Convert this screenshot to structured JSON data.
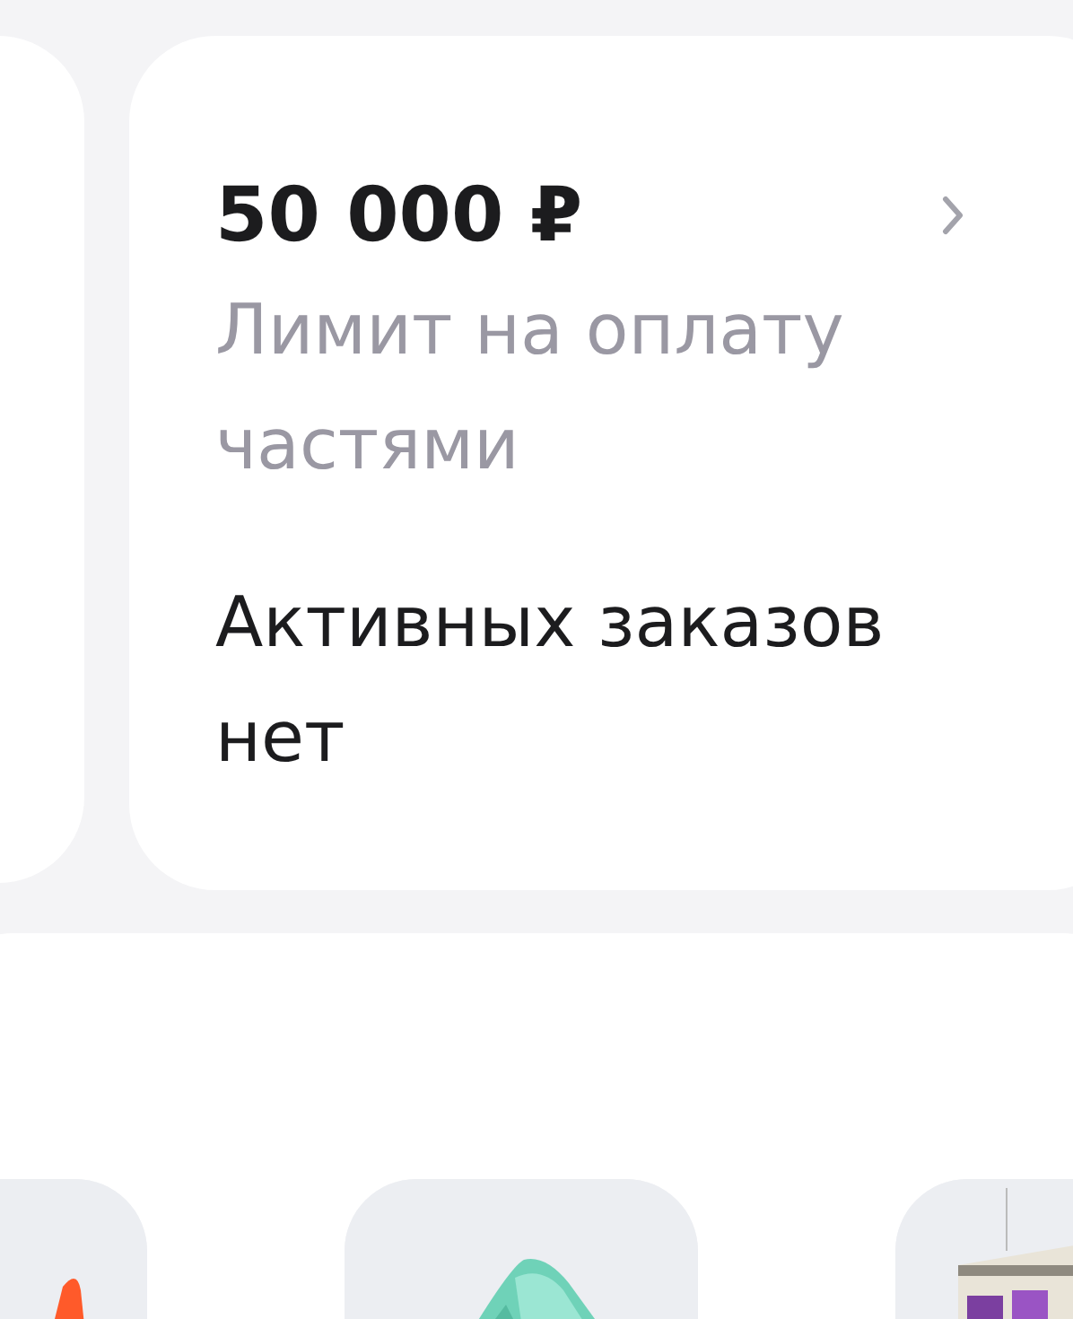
{
  "limit_card": {
    "amount": "50 000 ₽",
    "caption": "Лимит на оплату частями",
    "orders_status": "Активных заказов нет"
  }
}
